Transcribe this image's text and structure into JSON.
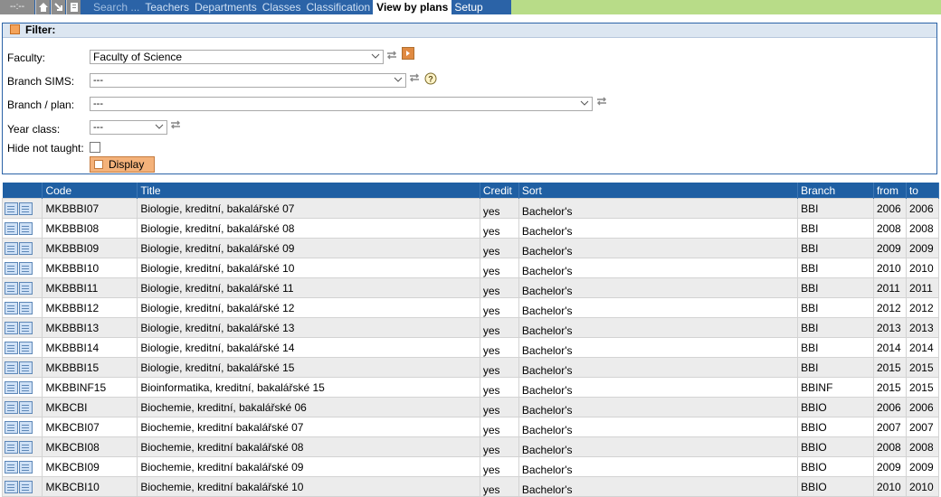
{
  "nav": {
    "clock": "--:--",
    "items": [
      "Search ...",
      "Teachers",
      "Departments",
      "Classes",
      "Classification",
      "View by plans",
      "Setup"
    ],
    "active": "View by plans"
  },
  "filter": {
    "title": "Filter:",
    "faculty_label": "Faculty:",
    "faculty_value": "Faculty of Science",
    "branch_sims_label": "Branch SIMS:",
    "branch_sims_value": "---",
    "branch_plan_label": "Branch / plan:",
    "branch_plan_value": "---",
    "year_class_label": "Year class:",
    "year_class_value": "---",
    "hide_label": "Hide not taught:",
    "display_button": "Display"
  },
  "table": {
    "headers": [
      "Code",
      "Title",
      "Credit",
      "Sort",
      "Branch",
      "from",
      "to"
    ],
    "rows": [
      [
        "MKBBBI07",
        "Biologie, kreditní, bakalářské 07",
        "yes",
        "Bachelor's",
        "BBI",
        "2006",
        "2006"
      ],
      [
        "MKBBBI08",
        "Biologie, kreditní, bakalářské 08",
        "yes",
        "Bachelor's",
        "BBI",
        "2008",
        "2008"
      ],
      [
        "MKBBBI09",
        "Biologie, kreditní, bakalářské 09",
        "yes",
        "Bachelor's",
        "BBI",
        "2009",
        "2009"
      ],
      [
        "MKBBBI10",
        "Biologie, kreditní, bakalářské 10",
        "yes",
        "Bachelor's",
        "BBI",
        "2010",
        "2010"
      ],
      [
        "MKBBBI11",
        "Biologie, kreditní, bakalářské 11",
        "yes",
        "Bachelor's",
        "BBI",
        "2011",
        "2011"
      ],
      [
        "MKBBBI12",
        "Biologie, kreditní, bakalářské 12",
        "yes",
        "Bachelor's",
        "BBI",
        "2012",
        "2012"
      ],
      [
        "MKBBBI13",
        "Biologie, kreditní, bakalářské 13",
        "yes",
        "Bachelor's",
        "BBI",
        "2013",
        "2013"
      ],
      [
        "MKBBBI14",
        "Biologie, kreditní, bakalářské 14",
        "yes",
        "Bachelor's",
        "BBI",
        "2014",
        "2014"
      ],
      [
        "MKBBBI15",
        "Biologie, kreditní, bakalářské 15",
        "yes",
        "Bachelor's",
        "BBI",
        "2015",
        "2015"
      ],
      [
        "MKBBINF15",
        "Bioinformatika, kreditní, bakalářské 15",
        "yes",
        "Bachelor's",
        "BBINF",
        "2015",
        "2015"
      ],
      [
        "MKBCBI",
        "Biochemie, kreditní, bakalářské 06",
        "yes",
        "Bachelor's",
        "BBIO",
        "2006",
        "2006"
      ],
      [
        "MKBCBI07",
        "Biochemie, kreditní bakalářské 07",
        "yes",
        "Bachelor's",
        "BBIO",
        "2007",
        "2007"
      ],
      [
        "MKBCBI08",
        "Biochemie, kreditní bakalářské 08",
        "yes",
        "Bachelor's",
        "BBIO",
        "2008",
        "2008"
      ],
      [
        "MKBCBI09",
        "Biochemie, kreditní bakalářské 09",
        "yes",
        "Bachelor's",
        "BBIO",
        "2009",
        "2009"
      ],
      [
        "MKBCBI10",
        "Biochemie, kreditní bakalářské 10",
        "yes",
        "Bachelor's",
        "BBIO",
        "2010",
        "2010"
      ]
    ]
  }
}
